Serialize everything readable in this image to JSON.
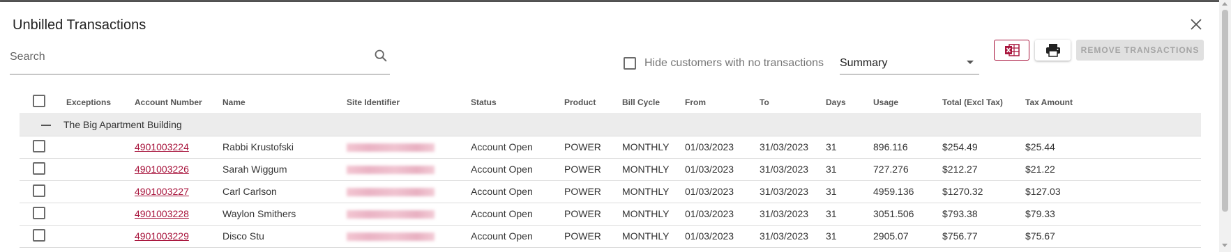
{
  "dialog": {
    "title": "Unbilled Transactions"
  },
  "toolbar": {
    "search_placeholder": "Search",
    "hide_no_transactions_label": "Hide customers with no transactions",
    "view_select_value": "Summary",
    "remove_button_label": "REMOVE TRANSACTIONS"
  },
  "icons": {
    "close": "close-icon",
    "search": "search-icon",
    "excel": "excel-icon",
    "print": "print-icon"
  },
  "colors": {
    "accent": "#a8143c",
    "group_row_bg": "#ececec",
    "disabled_button_bg": "#e0e0e0"
  },
  "table": {
    "columns": [
      "Exceptions",
      "Account Number",
      "Name",
      "Site Identifier",
      "Status",
      "Product",
      "Bill Cycle",
      "From",
      "To",
      "Days",
      "Usage",
      "Total (Excl Tax)",
      "Tax Amount"
    ],
    "group": "The Big Apartment Building",
    "rows": [
      {
        "exceptions": "",
        "account": "4901003224",
        "name": "Rabbi Krustofski",
        "status": "Account Open",
        "product": "POWER",
        "cycle": "MONTHLY",
        "from": "01/03/2023",
        "to": "31/03/2023",
        "days": "31",
        "usage": "896.116",
        "total": "$254.49",
        "tax": "$25.44"
      },
      {
        "exceptions": "",
        "account": "4901003226",
        "name": "Sarah Wiggum",
        "status": "Account Open",
        "product": "POWER",
        "cycle": "MONTHLY",
        "from": "01/03/2023",
        "to": "31/03/2023",
        "days": "31",
        "usage": "727.276",
        "total": "$212.27",
        "tax": "$21.22"
      },
      {
        "exceptions": "",
        "account": "4901003227",
        "name": "Carl Carlson",
        "status": "Account Open",
        "product": "POWER",
        "cycle": "MONTHLY",
        "from": "01/03/2023",
        "to": "31/03/2023",
        "days": "31",
        "usage": "4959.136",
        "total": "$1270.32",
        "tax": "$127.03"
      },
      {
        "exceptions": "",
        "account": "4901003228",
        "name": "Waylon Smithers",
        "status": "Account Open",
        "product": "POWER",
        "cycle": "MONTHLY",
        "from": "01/03/2023",
        "to": "31/03/2023",
        "days": "31",
        "usage": "3051.506",
        "total": "$793.38",
        "tax": "$79.33"
      },
      {
        "exceptions": "",
        "account": "4901003229",
        "name": "Disco Stu",
        "status": "Account Open",
        "product": "POWER",
        "cycle": "MONTHLY",
        "from": "01/03/2023",
        "to": "31/03/2023",
        "days": "31",
        "usage": "2905.07",
        "total": "$756.77",
        "tax": "$75.67"
      }
    ]
  }
}
